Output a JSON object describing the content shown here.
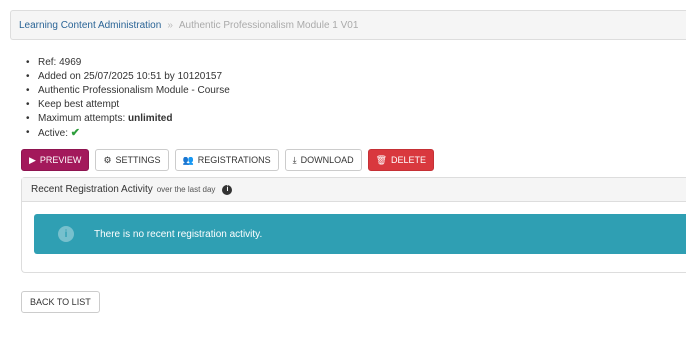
{
  "breadcrumb": {
    "parent": "Learning Content Administration",
    "separator": "»",
    "current": "Authentic Professionalism Module 1 V01"
  },
  "details": {
    "ref": "Ref: 4969",
    "added": "Added on 25/07/2025 10:51 by 10120157",
    "type": "Authentic Professionalism Module - Course",
    "attempt_mode": "Keep best attempt",
    "max_attempts_label": "Maximum attempts:",
    "max_attempts_value": "unlimited",
    "active_label": "Active:",
    "active_icon": "check-icon",
    "active_mark": "✔"
  },
  "toolbar": {
    "preview": "Preview",
    "settings": "Settings",
    "registrations": "Registrations",
    "download": "Download",
    "delete": "Delete"
  },
  "panel": {
    "title": "Recent Registration Activity",
    "subtitle": "over the last day",
    "alert": "There is no recent registration activity."
  },
  "back_label": "Back to list",
  "colors": {
    "preview": "#a3195b",
    "delete": "#d9383e",
    "alert": "#2f9fb3",
    "link": "#2a6496"
  }
}
